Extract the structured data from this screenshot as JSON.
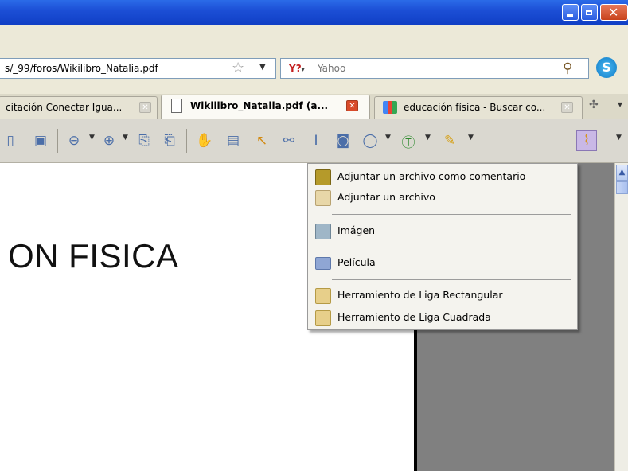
{
  "browser": {
    "address": "s/_99/foros/Wikilibro_Natalia.pdf",
    "search_provider": "Y?",
    "search_placeholder": "Yahoo",
    "skype_label": "S"
  },
  "tabs": [
    {
      "label": "citación Conectar Igua...",
      "active": false,
      "icon": "none"
    },
    {
      "label": "Wikilibro_Natalia.pdf (a...",
      "active": true,
      "icon": "pdf-document-icon"
    },
    {
      "label": "educación física - Buscar co...",
      "active": false,
      "icon": "google-icon"
    }
  ],
  "tab_controls": {
    "new_tab": "✣",
    "list_tabs": "▾"
  },
  "pdf_toolbar": {
    "buttons": [
      "page-icon",
      "page-fit-icon",
      "zoom-out-icon",
      "zoom-in-icon",
      "page-navigate-icon",
      "page-extract-icon",
      "hand-tool-icon",
      "select-text-icon",
      "select-arrow-icon",
      "find-binoculars-icon",
      "text-field-icon",
      "snapshot-icon",
      "shape-circle-icon",
      "text-annotation-icon",
      "highlight-pen-icon",
      "attach-paperclip-icon"
    ]
  },
  "document": {
    "heading": "ON FISICA"
  },
  "attach_menu": {
    "items": [
      {
        "label": "Adjuntar un archivo como comentario",
        "icon": "attach-comment-icon"
      },
      {
        "label": "Adjuntar un archivo",
        "icon": "attach-file-icon"
      },
      {
        "label": "Imágen",
        "icon": "image-icon"
      },
      {
        "label": "Película",
        "icon": "movie-icon"
      },
      {
        "label": "Herramiento de Liga Rectangular",
        "icon": "link-rect-icon"
      },
      {
        "label": "Herramiento de Liga Cuadrada",
        "icon": "link-square-icon"
      }
    ]
  },
  "colors": {
    "titlebar": "#1c4fd6",
    "close": "#c8421b",
    "menu_bg": "#f4f3ee",
    "doc_gray": "#808080"
  }
}
